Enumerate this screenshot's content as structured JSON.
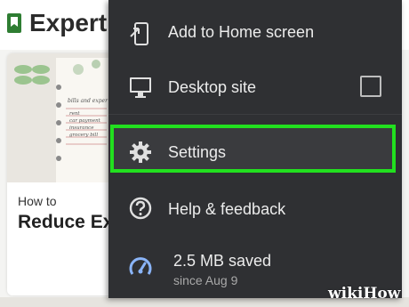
{
  "background_page": {
    "title": "Expert Q",
    "card": {
      "prefix": "How to",
      "title": "Reduce Exp"
    },
    "image_text": {
      "heading": "bills and exper",
      "rows": [
        "rent",
        "car payment",
        "insurance",
        "grocery bill"
      ]
    }
  },
  "menu": {
    "items": [
      {
        "label": "Add to Home screen",
        "icon": "add-to-home-screen-icon"
      },
      {
        "label": "Desktop site",
        "icon": "desktop-monitor-icon",
        "checked": false
      },
      {
        "label": "Settings",
        "icon": "gear-icon",
        "highlighted": true
      },
      {
        "label": "Help & feedback",
        "icon": "help-circle-icon"
      }
    ],
    "data_saver": {
      "title": "2.5 MB saved",
      "subtitle": "since Aug 9",
      "icon": "speedometer-icon"
    }
  },
  "watermark": "wikiHow",
  "colors": {
    "menu_bg": "#2f3033",
    "highlight": "#22e01f",
    "icon_accent": "#8ab4f8",
    "bookmark": "#2e7d32"
  }
}
